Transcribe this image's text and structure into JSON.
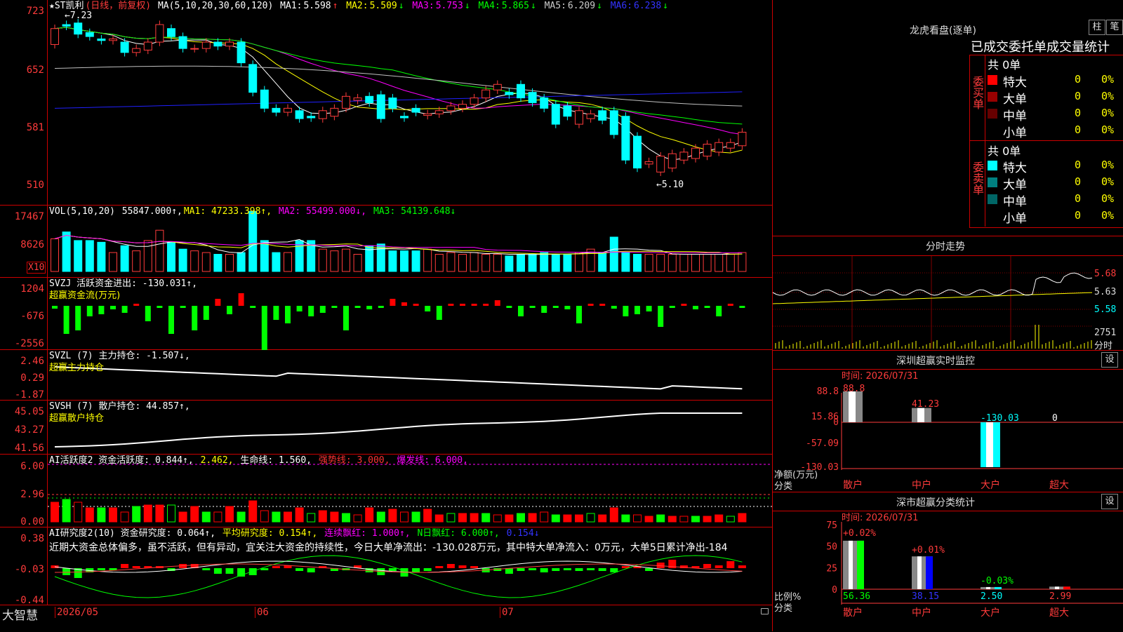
{
  "stock": {
    "title": "★ST凯利",
    "period": "(日线，前复权)",
    "ma_label": "MA(5,10,20,30,60,120)",
    "ma": [
      {
        "label": "MA1:",
        "value": "5.598",
        "arrow": "↑",
        "color": "#ffffff"
      },
      {
        "label": "MA2:",
        "value": "5.509",
        "arrow": "↓",
        "color": "#ffff00"
      },
      {
        "label": "MA3:",
        "value": "5.753",
        "arrow": "↓",
        "color": "#ff00ff"
      },
      {
        "label": "MA4:",
        "value": "5.865",
        "arrow": "↓",
        "color": "#00ff00"
      },
      {
        "label": "MA5:",
        "value": "6.209",
        "arrow": "↓",
        "color": "#c0c0c0"
      },
      {
        "label": "MA6:",
        "value": "6.238",
        "arrow": "↓",
        "color": "#2020ff"
      }
    ],
    "high_label": "←7.23",
    "low_label": "←5.10",
    "y_ticks": [
      "723",
      "652",
      "581",
      "510"
    ]
  },
  "vol": {
    "label": "VOL(5,10,20)",
    "value": "55847.000↑,",
    "ma1": "MA1: 47233.398↑,",
    "ma2": "MA2: 55499.000↓,",
    "ma3": "MA3: 54139.648↓",
    "y_ticks": [
      "17467",
      "8626"
    ],
    "unit": "X10"
  },
  "svzj": {
    "label": "SVZJ  活跃资金进出: -130.031↑,",
    "sub": "超赢资金流(万元)",
    "y_ticks": [
      "1204",
      "-676",
      "-2556"
    ]
  },
  "svzl": {
    "label": "SVZL (7) 主力持仓: -1.507↓,",
    "sub": "超赢主力持仓",
    "y_ticks": [
      "2.46",
      "0.29",
      "-1.87"
    ]
  },
  "svsh": {
    "label": "SVSH (7) 散户持仓: 44.857↑,",
    "sub": "超赢散户持仓",
    "y_ticks": [
      "45.05",
      "43.27",
      "41.56"
    ]
  },
  "ai_active": {
    "label": "AI活跃度2 资金活跃度: 0.844↑,",
    "v2": "2.462,",
    "life": "生命线: 1.560,",
    "strong": "强势线: 3.000,",
    "burst": "爆发线: 6.000,",
    "y_ticks": [
      "6.00",
      "2.96",
      "0.00"
    ]
  },
  "ai_research": {
    "label": "AI研究度2(10) 资金研究度: 0.064↑,",
    "avg": "平均研究度: 0.154↑,",
    "red": "连续飘红: 1.000↑,",
    "nday": "N日飘红: 6.000↑,",
    "v5": "0.154↓",
    "commentary": "近期大资金总体偏多，虽不活跃，但有异动，宜关注大资金的持续性，今日大单净流出：-130.028万元，其中特大单净流入：0万元，大单5日累计净出-184",
    "y_ticks": [
      "0.38",
      "-0.03",
      "-0.44"
    ]
  },
  "footer": {
    "brand": "大智慧",
    "dates": [
      "2026/05",
      "06",
      "07"
    ]
  },
  "right": {
    "dragon_title": "龙虎看盘(逐单)",
    "btn1": "柱",
    "btn2": "笔",
    "stats_title": "已成交委托单成交量统计",
    "buy_side": "委买单",
    "sell_side": "委卖单",
    "buy_total": "共 0单",
    "sell_total": "共 0单",
    "buy_rows": [
      {
        "label": "特大",
        "count": "0",
        "pct": "0%",
        "color": "#ff0000"
      },
      {
        "label": "大单",
        "count": "0",
        "pct": "0%",
        "color": "#990000"
      },
      {
        "label": "中单",
        "count": "0",
        "pct": "0%",
        "color": "#660000"
      },
      {
        "label": "小单",
        "count": "0",
        "pct": "0%",
        "color": "#000000"
      }
    ],
    "sell_rows": [
      {
        "label": "特大",
        "count": "0",
        "pct": "0%",
        "color": "#00ffff"
      },
      {
        "label": "大单",
        "count": "0",
        "pct": "0%",
        "color": "#008080"
      },
      {
        "label": "中单",
        "count": "0",
        "pct": "0%",
        "color": "#006666"
      },
      {
        "label": "小单",
        "count": "0",
        "pct": "0%",
        "color": "#000000"
      }
    ],
    "intraday_title": "分时走势",
    "intraday_ticks": [
      "5.68",
      "5.63",
      "5.58"
    ],
    "intraday_vol": "2751",
    "intraday_unit": "分时",
    "monitor_title": "深圳超赢实时监控",
    "monitor_btn": "设",
    "monitor_time": "时间: 2026/07/31",
    "monitor_ticks": [
      "88.8",
      "15.86",
      "0",
      "-57.09",
      "-130.03"
    ],
    "monitor_values": [
      "88.8",
      "41.23",
      "-130.03",
      "0"
    ],
    "monitor_ylabel": "净额(万元)",
    "monitor_xlabel": "分类",
    "monitor_cats": [
      "散户",
      "中户",
      "大户",
      "超大"
    ],
    "class_title": "深市超赢分类统计",
    "class_btn": "设",
    "class_time": "时间: 2026/07/31",
    "class_ticks": [
      "75",
      "50",
      "25",
      "0"
    ],
    "class_top": [
      "+0.02%",
      "+0.01%",
      "-0.03%"
    ],
    "class_values": [
      "56.36",
      "38.15",
      "2.50",
      "2.99"
    ],
    "class_ylabel": "比例%",
    "class_xlabel": "分类",
    "class_cats": [
      "散户",
      "中户",
      "大户",
      "超大"
    ]
  },
  "chart_data": {
    "type": "candlestick",
    "note_series": "daily candles, 60 sessions",
    "opens": [
      6.85,
      7.1,
      7.12,
      7.0,
      6.92,
      6.9,
      6.88,
      6.75,
      6.78,
      6.88,
      7.05,
      6.95,
      6.8,
      6.8,
      6.88,
      6.83,
      6.88,
      6.6,
      6.28,
      6.05,
      6.0,
      6.02,
      5.95,
      5.92,
      5.95,
      6.05,
      6.15,
      6.2,
      6.22,
      6.18,
      5.95,
      6.05,
      5.96,
      5.98,
      6.02,
      6.05,
      6.1,
      6.18,
      6.28,
      6.25,
      6.35,
      6.25,
      6.18,
      6.1,
      6.08,
      5.85,
      5.92,
      6.02,
      6.02,
      5.95,
      5.7,
      5.35,
      5.25,
      5.3,
      5.4,
      5.42,
      5.45,
      5.5,
      5.55,
      5.58
    ],
    "closes": [
      7.05,
      7.08,
      6.98,
      6.95,
      6.9,
      6.92,
      6.75,
      6.8,
      6.88,
      7.1,
      6.95,
      6.8,
      6.8,
      6.88,
      6.83,
      6.88,
      6.62,
      6.25,
      6.05,
      6.0,
      6.05,
      5.92,
      5.93,
      6.02,
      6.05,
      6.2,
      6.18,
      6.12,
      5.92,
      6.05,
      5.93,
      6.0,
      5.98,
      6.02,
      6.08,
      6.1,
      6.18,
      6.28,
      6.35,
      6.22,
      6.18,
      6.12,
      6.05,
      5.85,
      5.95,
      6.02,
      5.98,
      5.9,
      5.72,
      5.4,
      5.3,
      5.38,
      5.45,
      5.48,
      5.5,
      5.55,
      5.6,
      5.62,
      5.62,
      5.75
    ],
    "volumes": [
      9.5,
      11.5,
      9.0,
      9.0,
      8.5,
      5.5,
      7.5,
      6.0,
      9.0,
      12.0,
      8.5,
      6.5,
      6.0,
      5.5,
      5.0,
      5.0,
      5.5,
      17.5,
      9.0,
      5.5,
      5.5,
      9.0,
      9.0,
      6.5,
      6.0,
      6.5,
      5.0,
      7.5,
      8.0,
      6.0,
      6.0,
      6.0,
      6.5,
      5.0,
      5.5,
      5.0,
      5.5,
      5.0,
      5.0,
      4.5,
      5.0,
      5.0,
      5.5,
      5.0,
      5.0,
      5.5,
      6.5,
      5.5,
      10.0,
      5.5,
      5.0,
      5.0,
      5.0,
      5.0,
      5.0,
      5.0,
      5.0,
      5.0,
      5.0,
      5.5
    ],
    "ylim": [
      5.05,
      7.25
    ]
  }
}
